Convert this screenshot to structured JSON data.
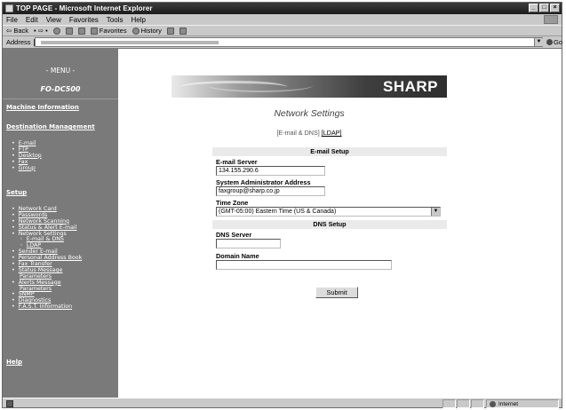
{
  "window": {
    "title": "TOP PAGE - Microsoft Internet Explorer",
    "controls": [
      "_",
      "□",
      "×"
    ]
  },
  "menubar": [
    "File",
    "Edit",
    "View",
    "Favorites",
    "Tools",
    "Help"
  ],
  "toolbar": {
    "back": "⇦ Back",
    "forward": "• ⇨ •",
    "favorites": "Favorites",
    "history": "History"
  },
  "addressbar": {
    "label": "Address",
    "go": "Go"
  },
  "sidebar": {
    "menu_label": "- MENU -",
    "model": "FO-DC500",
    "machine_information": "Machine Information",
    "destination_management": "Destination Management",
    "destination_items": [
      "E-mail",
      "FTP",
      "Desktop",
      "Fax",
      "Group"
    ],
    "setup": "Setup",
    "setup_items": [
      {
        "label": "Network Card",
        "link": true,
        "sub": false
      },
      {
        "label": "Passwords",
        "link": true,
        "sub": false
      },
      {
        "label": "Network Scanning",
        "link": true,
        "sub": false
      },
      {
        "label": "Status & Alert E-mail",
        "link": true,
        "sub": false
      },
      {
        "label": "Network Settings",
        "link": false,
        "sub": false
      },
      {
        "label": "E-mail & DNS",
        "link": true,
        "sub": true
      },
      {
        "label": "LDAP",
        "link": true,
        "sub": true
      },
      {
        "label": "Sender E-mail",
        "link": true,
        "sub": false
      },
      {
        "label": "Personal Address Book",
        "link": true,
        "sub": false
      },
      {
        "label": "Fax Transfer",
        "link": true,
        "sub": false
      },
      {
        "label": "Status Message",
        "link": true,
        "sub": false
      },
      {
        "label": "Parameters",
        "link": true,
        "sub": false,
        "continuation": true
      },
      {
        "label": "Alerts Message",
        "link": true,
        "sub": false
      },
      {
        "label": "Parameters",
        "link": true,
        "sub": false,
        "continuation": true
      },
      {
        "label": "SNMP",
        "link": true,
        "sub": false
      },
      {
        "label": "Diagnostics",
        "link": true,
        "sub": false
      },
      {
        "label": "F.A.S.T. Information",
        "link": true,
        "sub": false
      }
    ],
    "help": "Help"
  },
  "main": {
    "brand": "SHARP",
    "page_title": "Network Settings",
    "crumbs": {
      "current": "[E-mail & DNS]",
      "other": "[LDAP]"
    },
    "email_setup": {
      "heading": "E-mail Setup",
      "server_label": "E-mail Server",
      "server_value": "134.155.290.6",
      "admin_label": "System Administrator Address",
      "admin_value": "faxgroup@sharp.co.jp",
      "tz_label": "Time Zone",
      "tz_value": "(GMT-05:00) Eastern Time (US & Canada)"
    },
    "dns_setup": {
      "heading": "DNS Setup",
      "server_label": "DNS Server",
      "server_value": "",
      "domain_label": "Domain Name",
      "domain_value": ""
    },
    "submit_label": "Submit"
  },
  "statusbar": {
    "zone": "Internet"
  }
}
